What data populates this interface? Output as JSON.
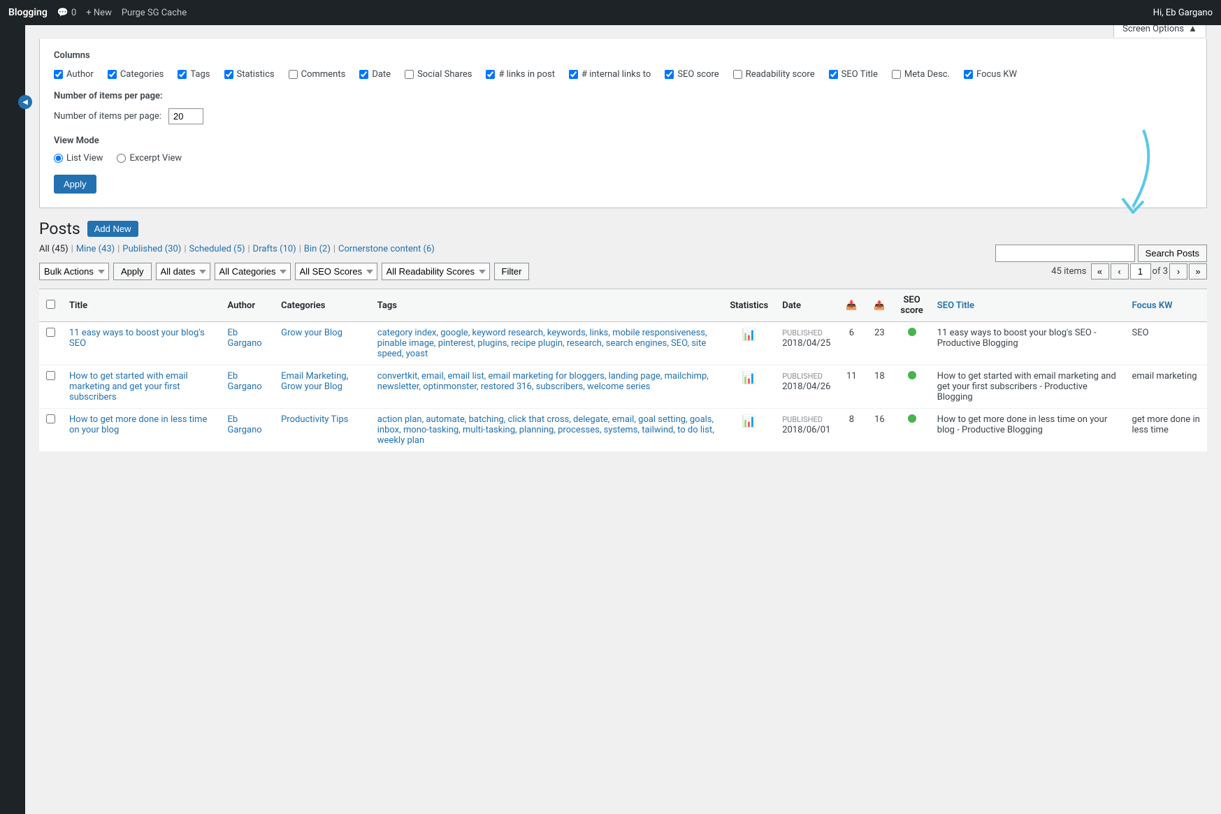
{
  "adminBar": {
    "brand": "Blogging",
    "items": [
      {
        "label": "0",
        "icon": "comment-icon"
      },
      {
        "label": "+ New"
      },
      {
        "label": "Purge SG Cache"
      }
    ],
    "right": "Hi, Eb Gargano"
  },
  "screenOptions": {
    "title": "Columns",
    "applyLabel": "Apply",
    "columns": [
      {
        "label": "Author",
        "checked": true
      },
      {
        "label": "Categories",
        "checked": true
      },
      {
        "label": "Tags",
        "checked": true
      },
      {
        "label": "Statistics",
        "checked": true
      },
      {
        "label": "Comments",
        "checked": false
      },
      {
        "label": "Date",
        "checked": true
      },
      {
        "label": "Social Shares",
        "checked": false
      },
      {
        "label": "# links in post",
        "checked": true
      },
      {
        "label": "# internal links to",
        "checked": true
      },
      {
        "label": "SEO score",
        "checked": true
      },
      {
        "label": "Readability score",
        "checked": false
      },
      {
        "label": "SEO Title",
        "checked": true
      },
      {
        "label": "Meta Desc.",
        "checked": false
      },
      {
        "label": "Focus KW",
        "checked": true
      }
    ],
    "pagination": {
      "label": "Number of items per page:",
      "value": "20"
    },
    "viewMode": {
      "label": "View Mode",
      "options": [
        {
          "label": "List View",
          "value": "list",
          "selected": true
        },
        {
          "label": "Excerpt View",
          "value": "excerpt",
          "selected": false
        }
      ]
    }
  },
  "screenOptionsToggle": "Screen Options",
  "posts": {
    "title": "Posts",
    "addNewLabel": "Add New",
    "filterLinks": [
      {
        "label": "All",
        "count": "45",
        "active": true
      },
      {
        "label": "Mine",
        "count": "43"
      },
      {
        "label": "Published",
        "count": "30"
      },
      {
        "label": "Scheduled",
        "count": "5"
      },
      {
        "label": "Drafts",
        "count": "10"
      },
      {
        "label": "Bin",
        "count": "2"
      },
      {
        "label": "Cornerstone content",
        "count": "6"
      }
    ],
    "search": {
      "placeholder": "",
      "buttonLabel": "Search Posts"
    },
    "toolbar": {
      "bulkActionsLabel": "Bulk Actions",
      "applyLabel": "Apply",
      "datesOptions": [
        "All dates"
      ],
      "categoriesOptions": [
        "All Categories"
      ],
      "seoScoresOptions": [
        "All SEO Scores"
      ],
      "readabilityOptions": [
        "All Readability Scores"
      ],
      "filterLabel": "Filter",
      "itemsInfo": "45 items",
      "pageInfo": "1",
      "totalPages": "3"
    },
    "tableHeaders": [
      {
        "label": "Title",
        "key": "title"
      },
      {
        "label": "Author",
        "key": "author"
      },
      {
        "label": "Categories",
        "key": "categories"
      },
      {
        "label": "Tags",
        "key": "tags"
      },
      {
        "label": "Statistics",
        "key": "statistics"
      },
      {
        "label": "Date",
        "key": "date"
      },
      {
        "label": "",
        "key": "links1"
      },
      {
        "label": "",
        "key": "links2"
      },
      {
        "label": "SEO score",
        "key": "seo"
      },
      {
        "label": "SEO Title",
        "key": "seotitle"
      },
      {
        "label": "Focus KW",
        "key": "focuskw"
      }
    ],
    "rows": [
      {
        "title": "11 easy ways to boost your blog's SEO",
        "author": "Eb Gargano",
        "categories": [
          "Grow your Blog"
        ],
        "tags": [
          "category index",
          "google",
          "keyword research",
          "keywords",
          "links",
          "mobile responsiveness",
          "pinable image",
          "pinterest",
          "plugins",
          "recipe plugin",
          "research",
          "search engines",
          "SEO",
          "site speed",
          "yoast"
        ],
        "hasStats": true,
        "dateStatus": "Published",
        "date": "2018/04/25",
        "linksIn": "6",
        "linksTo": "23",
        "seoStatus": "green",
        "seoTitle": "11 easy ways to boost your blog's SEO - Productive Blogging",
        "focusKW": "SEO"
      },
      {
        "title": "How to get started with email marketing and get your first subscribers",
        "author": "Eb Gargano",
        "categories": [
          "Email Marketing",
          "Grow your Blog"
        ],
        "tags": [
          "convertkit",
          "email",
          "email list",
          "email marketing for bloggers",
          "landing page",
          "mailchimp",
          "newsletter",
          "optinmonster",
          "restored 316",
          "subscribers",
          "welcome series"
        ],
        "hasStats": true,
        "dateStatus": "Published",
        "date": "2018/04/26",
        "linksIn": "11",
        "linksTo": "18",
        "seoStatus": "green",
        "seoTitle": "How to get started with email marketing and get your first subscribers - Productive Blogging",
        "focusKW": "email marketing"
      },
      {
        "title": "How to get more done in less time on your blog",
        "author": "Eb Gargano",
        "categories": [
          "Productivity Tips"
        ],
        "tags": [
          "action plan",
          "automate",
          "batching",
          "click that cross",
          "delegate",
          "email",
          "goal setting",
          "goals",
          "inbox",
          "mono-tasking",
          "multi-tasking",
          "planning",
          "processes",
          "systems",
          "tailwind",
          "to do list",
          "weekly plan"
        ],
        "hasStats": true,
        "dateStatus": "Published",
        "date": "2018/06/01",
        "linksIn": "8",
        "linksTo": "16",
        "seoStatus": "green",
        "seoTitle": "How to get more done in less time on your blog - Productive Blogging",
        "focusKW": "get more done in less time"
      }
    ]
  }
}
